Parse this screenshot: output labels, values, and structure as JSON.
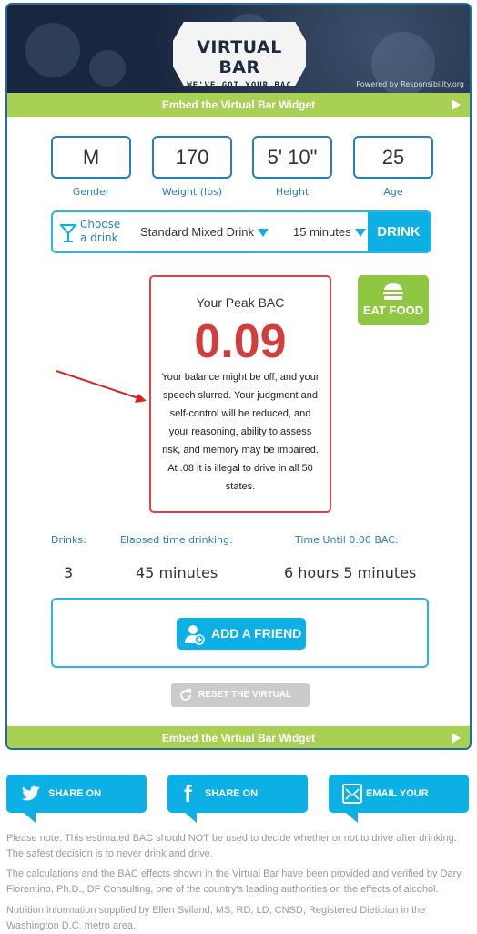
{
  "header": {
    "logo_title": "VIRTUAL BAR",
    "logo_tagline": "WE'VE GOT YOUR BAC",
    "powered_by": "Powered by Responsibility.org"
  },
  "embed_label": "Embed the Virtual Bar Widget",
  "profile": [
    {
      "value": "M",
      "label": "Gender"
    },
    {
      "value": "170",
      "label": "Weight (lbs)"
    },
    {
      "value": "5' 10\"",
      "label": "Height"
    },
    {
      "value": "25",
      "label": "Age"
    }
  ],
  "drink": {
    "choose_line1": "Choose",
    "choose_line2": "a drink",
    "drink_type": "Standard Mixed Drink",
    "interval": "15 minutes",
    "button": "DRINK"
  },
  "bac": {
    "title": "Your Peak BAC",
    "value": "0.09",
    "description": "Your balance might be off, and your speech slurred. Your judgment and self-control will be reduced, and your reasoning, ability to assess risk, and memory may be impaired. At .08 it is illegal to drive in all 50 states."
  },
  "eat_food": "EAT FOOD",
  "stats": {
    "drinks_label": "Drinks:",
    "drinks_value": "3",
    "elapsed_label": "Elapsed time drinking:",
    "elapsed_value": "45 minutes",
    "until_label": "Time Until 0.00 BAC:",
    "until_value": "6 hours 5 minutes"
  },
  "add_friend": "ADD A FRIEND",
  "reset": "RESET THE VIRTUAL BAR",
  "share": {
    "twitter": "SHARE ON TWITTER",
    "facebook": "SHARE ON FACEBOOK",
    "email": "EMAIL YOUR FRIENDS"
  },
  "notes": [
    "Please note: This estimated BAC should NOT be used to decide whether or not to drive after drinking. The safest decision is to never drink and drive.",
    "The calculations and the BAC effects shown in the Virtual Bar have been provided and verified by Dary Fiorentino, Ph.D., DF Consulting, one of the country's leading authorities on the effects of alcohol.",
    "Nutrition information supplied by Ellen Sviland, MS, RD, LD, CNSD, Registered Dietician in the Washington D.C. metro area."
  ],
  "colors": {
    "accent_blue": "#0cb0e5",
    "green": "#a8d052",
    "bac_red": "#d43d3d",
    "annotation_arrow": "#e02020"
  }
}
